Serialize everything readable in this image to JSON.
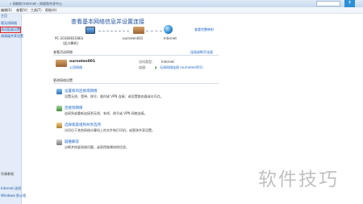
{
  "titlebar": {
    "breadcrumb": "« 网络和 Internet › 网络和共享中心",
    "help_glyph": "?"
  },
  "menubar": {
    "items": [
      "编辑(E)",
      "查看(V)",
      "工具(T)",
      "帮助(H)"
    ]
  },
  "sidebar": {
    "items": [
      {
        "label": "主页"
      },
      {
        "label": "理无线网络"
      },
      {
        "label": "改适配器设置"
      },
      {
        "label": "改高级共享设置"
      },
      {
        "label": "另请参阅"
      },
      {
        "label": "Internet 选项"
      },
      {
        "label": "Windows 防火墙"
      }
    ]
  },
  "main": {
    "title": "查看基本网络信息并设置连接",
    "view_full_map": "查看完整映射",
    "map": {
      "computer_name": "PC-20180831NEU",
      "computer_sub": "(此计算机)",
      "network_name": "ournelen001",
      "internet_label": "Internet"
    },
    "active_networks": {
      "heading": "查看活动网络",
      "connect_disconnect": "连接或断开连接",
      "network_name": "ournelen001",
      "network_type": "公用网络",
      "access_type_label": "访问类型:",
      "access_type_value": "Internet",
      "connections_label": "连接:",
      "connections_value": "无线网络连接 (ournelen001)"
    },
    "change_settings": {
      "heading": "更改网络设置",
      "tasks": [
        {
          "title": "设置新的连接或网络",
          "desc": "设置无线、宽带、拨号、临时或 VPN 连接；或设置路由器或访问点。"
        },
        {
          "title": "连接到网络",
          "desc": "连接到或重新连接到无线、有线、拨号或 VPN 网络连接。"
        },
        {
          "title": "选择家庭组和共享选项",
          "desc": "访问位于其他网络计算机上的文件和打印机，或更改共享设置。"
        },
        {
          "title": "疑难解答",
          "desc": "诊断并修复网络问题，或获得故障排除信息。"
        }
      ]
    }
  },
  "watermark": "软件技巧",
  "colors": {
    "link": "#1a66c9",
    "title": "#1c4f9c",
    "sidebar_bg": "#e3ecf8",
    "selected_outline": "#e02020"
  }
}
